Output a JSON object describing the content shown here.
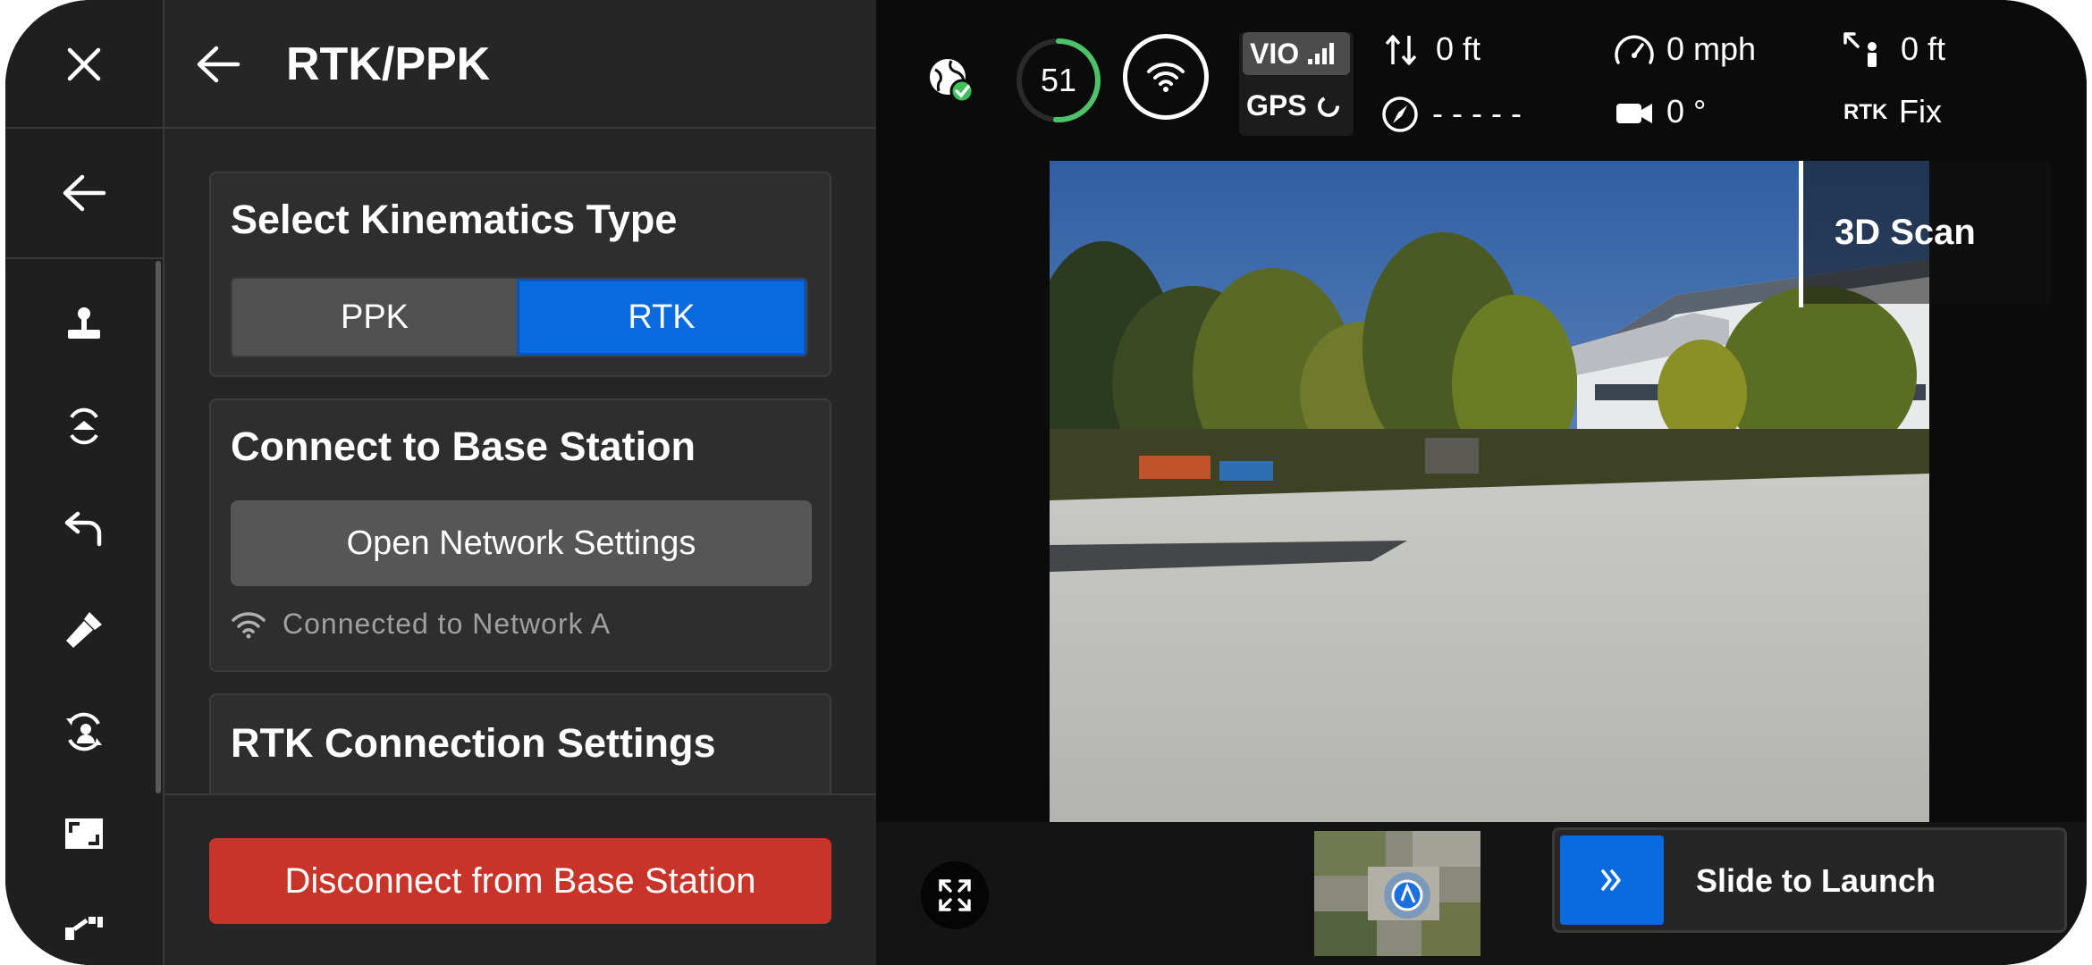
{
  "colors": {
    "accent_blue": "#0a6be0",
    "danger_red": "#c8342a",
    "battery_green": "#4cc26a",
    "status_green": "#3fbf5a"
  },
  "rail": {
    "icons": [
      "close-icon",
      "back-arrow-icon",
      "joystick-icon",
      "takeoff-icon",
      "return-icon",
      "flashlight-icon",
      "swap-user-icon",
      "aspect-ratio-icon",
      "tools-icon"
    ]
  },
  "panel": {
    "title": "RTK/PPK",
    "kinematics": {
      "title": "Select Kinematics Type",
      "options": [
        "PPK",
        "RTK"
      ],
      "selected": "RTK"
    },
    "base_station": {
      "title": "Connect to Base Station",
      "open_network_label": "Open Network Settings",
      "status_text": "Connected to Network A"
    },
    "rtk_connection": {
      "title": "RTK Connection Settings"
    },
    "disconnect_label": "Disconnect from Base Station"
  },
  "hud": {
    "battery": "51",
    "battery_level": 0.51,
    "vio_label": "VIO",
    "gps_label": "GPS",
    "vertical_distance": "0 ft",
    "heading": "- - - - -",
    "speed": "0 mph",
    "gimbal_angle": "0 °",
    "distance_from_pilot": "0 ft",
    "rtk_label": "RTK",
    "rtk_status": "Fix"
  },
  "camera": {
    "mode_label": "3D Scan"
  },
  "launch": {
    "slide_label": "Slide to Launch"
  }
}
